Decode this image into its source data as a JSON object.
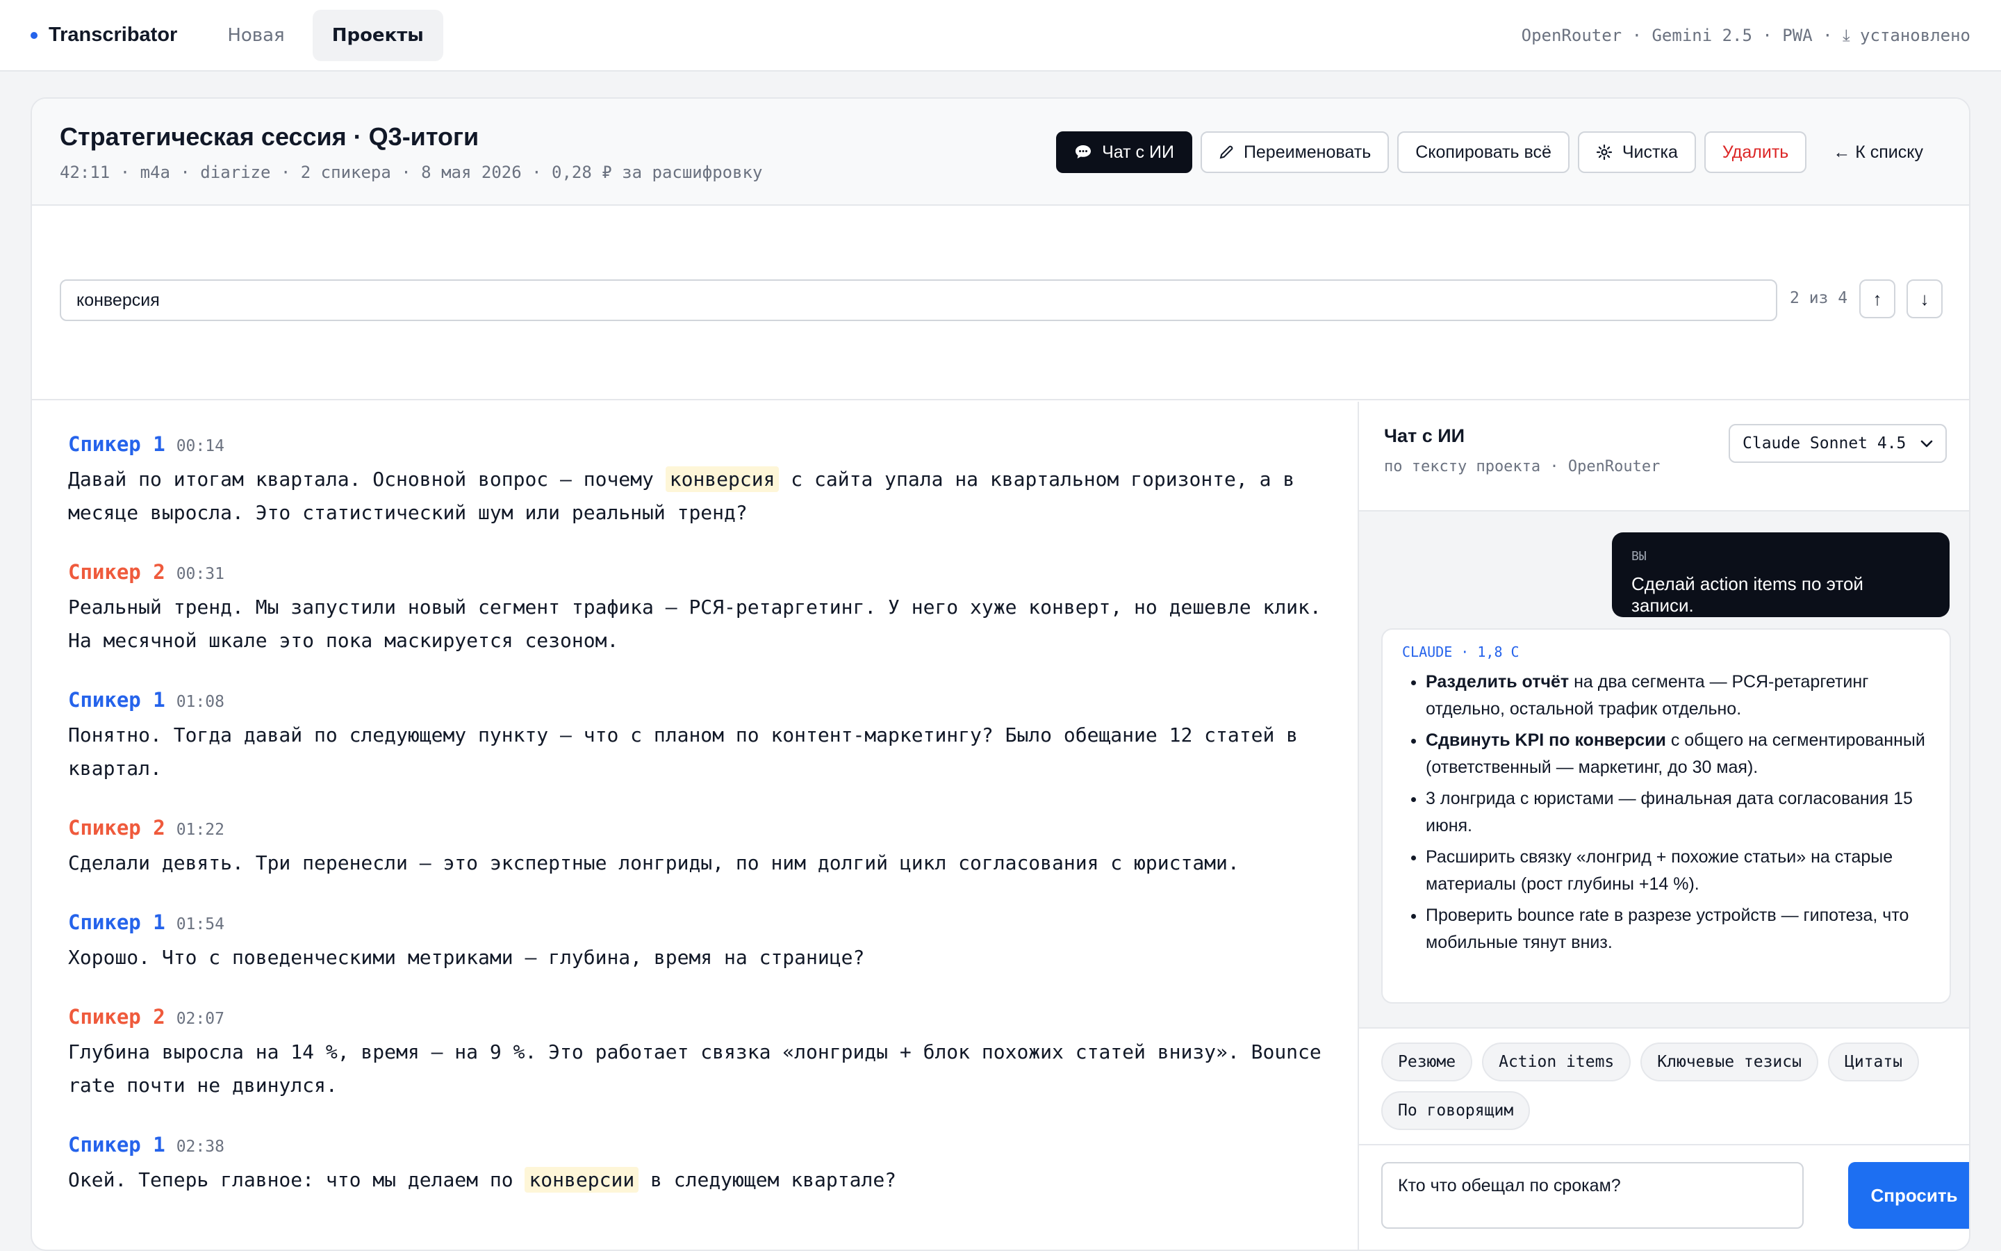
{
  "app": {
    "name": "Transcribator",
    "accent_color": "#2563eb",
    "nav": [
      "Новая",
      "Проекты"
    ],
    "active_nav": "Проекты",
    "status_text": "OpenRouter · Gemini 2.5  ·  PWA · ⤓ установлено"
  },
  "project": {
    "title": "Стратегическая сессия · Q3-итоги",
    "meta": "42:11 · m4a · diarize · 2 спикера · 8 мая 2026 · 0,28 ₽ за расшифровку"
  },
  "actions": {
    "chat": "Чат с ИИ",
    "rename": "Переименовать",
    "copy_all": "Скопировать всё",
    "clean": "Чистка",
    "delete": "Удалить",
    "back": "← К списку"
  },
  "search": {
    "value": "конверсия",
    "count": "2 из 4",
    "prev": "↑",
    "next": "↓"
  },
  "transcript": [
    {
      "speaker": "Спикер 1",
      "time": "00:14",
      "before": "Давай по итогам квартала. Основной вопрос — почему ",
      "highlight": "конверсия",
      "after": " с сайта упала на квартальном горизонте, а в месяце выросла. Это статистический шум или реальный тренд?"
    },
    {
      "speaker": "Спикер 2",
      "time": "00:31",
      "before": "Реальный тренд. Мы запустили новый сегмент трафика — РСЯ-ретаргетинг. У него хуже конверт, но дешевле клик. На месячной шкале это пока маскируется сезоном.",
      "highlight": "",
      "after": ""
    },
    {
      "speaker": "Спикер 1",
      "time": "01:08",
      "before": "Понятно. Тогда давай по следующему пункту — что с планом по контент-маркетингу? Было обещание 12 статей в квартал.",
      "highlight": "",
      "after": ""
    },
    {
      "speaker": "Спикер 2",
      "time": "01:22",
      "before": "Сделали девять. Три перенесли — это экспертные лонгриды, по ним долгий цикл согласования с юристами.",
      "highlight": "",
      "after": ""
    },
    {
      "speaker": "Спикер 1",
      "time": "01:54",
      "before": "Хорошо. Что с поведенческими метриками — глубина, время на странице?",
      "highlight": "",
      "after": ""
    },
    {
      "speaker": "Спикер 2",
      "time": "02:07",
      "before": "Глубина выросла на 14 %, время — на 9 %. Это работает связка «лонгриды + блок похожих статей внизу». Bounce rate почти не двинулся.",
      "highlight": "",
      "after": ""
    },
    {
      "speaker": "Спикер 1",
      "time": "02:38",
      "before": "Окей. Теперь главное: что мы делаем по ",
      "highlight": "конверсии",
      "after": " в следующем квартале?"
    }
  ],
  "chat": {
    "title": "Чат с ИИ",
    "subtitle": "по тексту проекта · OpenRouter",
    "model": "Claude Sonnet 4.5",
    "user_label": "ВЫ",
    "user_message": "Сделай action items по этой записи.",
    "ai_label": "CLAUDE · 1,8 С",
    "ai_items": [
      {
        "bold": "Разделить отчёт",
        "text": " на два сегмента — РСЯ-ретаргетинг отдельно, остальной трафик отдельно."
      },
      {
        "bold": "Сдвинуть KPI по конверсии",
        "text": " с общего на сегментированный (ответственный — маркетинг, до 30 мая)."
      },
      {
        "bold": "",
        "text": "3 лонгрида с юристами — финальная дата согласования 15 июня."
      },
      {
        "bold": "",
        "text": "Расширить связку «лонгрид + похожие статьи» на старые материалы (рост глубины +14 %)."
      },
      {
        "bold": "",
        "text": "Проверить bounce rate в разрезе устройств — гипотеза, что мобильные тянут вниз."
      }
    ],
    "chips": [
      "Резюме",
      "Action items",
      "Ключевые тезисы",
      "Цитаты",
      "По говорящим"
    ],
    "input_value": "Кто что обещал по срокам?",
    "ask_label": "Спросить"
  }
}
